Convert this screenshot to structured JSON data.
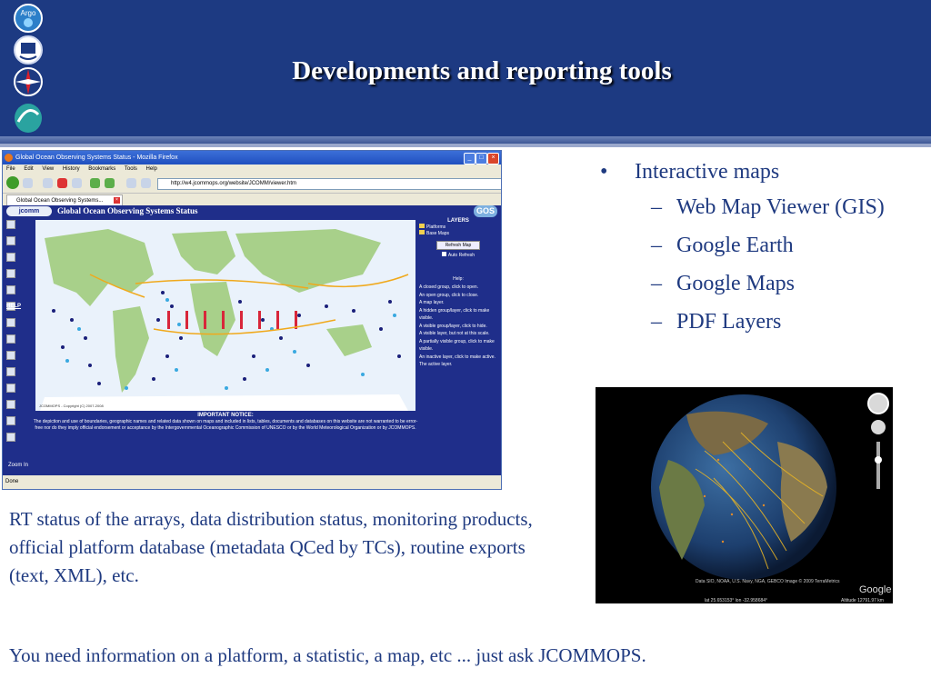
{
  "slide": {
    "title": "Developments and reporting tools",
    "logos": [
      {
        "name": "argo-logo",
        "label": "Argo"
      },
      {
        "name": "ioc-unesco-logo"
      },
      {
        "name": "wmo-compass-logo"
      },
      {
        "name": "jcommops-logo"
      }
    ]
  },
  "browser": {
    "window_title": "Global Ocean Observing Systems Status - Mozilla Firefox",
    "menu": [
      "File",
      "Edit",
      "View",
      "History",
      "Bookmarks",
      "Tools",
      "Help"
    ],
    "url": "http://w4.jcommops.org/website/JCOMM/viewer.htm",
    "tab_label": "Global Ocean Observing Systems...",
    "status": "Done",
    "app": {
      "logo_text": "jcomm",
      "title": "Global Ocean Observing Systems Status",
      "gos_label": "GOS",
      "help_link": "HELP",
      "layers_header": "LAYERS",
      "layer_items": [
        "Platforms",
        "Base Maps"
      ],
      "refresh_button": "Refresh Map",
      "auto_refresh": "Auto Refresh",
      "help_header": "Help:",
      "help_items": [
        "A closed group, click to open.",
        "An open group, click to close.",
        "A map layer.",
        "A hidden group/layer, click to make visible.",
        "A visible group/layer, click to hide.",
        "A visible layer, but not at this scale.",
        "A partially visible group, click to make visible.",
        "An inactive layer, click to make active.",
        "The active layer."
      ],
      "map_copyright": "JCOMMOPS - Copyright (C) 2007-2008",
      "notice_title": "IMPORTANT NOTICE:",
      "notice_text": "The depiction and use of boundaries, geographic names and related data shown on maps and included in lists, tables, documents and databases on this website are not warranted to be error-free nor do they imply official endorsement or acceptance by the Intergovernmental Oceanographic Commission of UNESCO or by the World Meteorological Organization or by JCOMMOPS.",
      "zoom_label": "Zoom In"
    }
  },
  "bullets": {
    "main": "Interactive maps",
    "sub": [
      "Web Map Viewer (GIS)",
      "Google Earth",
      "Google Maps",
      "PDF Layers"
    ]
  },
  "earth": {
    "attribution": "Data SIO, NOAA, U.S. Navy, NGA, GEBCO\nImage © 2009 TerraMetrics",
    "coords": "lat  25.653153°   lon  -32.958684°",
    "altitude": "Altitude 12791.97 km",
    "brand": "Google"
  },
  "caption": "RT status of the arrays, data distribution status, monitoring products, official platform database (metadata QCed by TCs), routine exports  (text, XML), etc.",
  "footer": "You need information on a platform, a statistic, a map, etc ... just ask JCOMMOPS."
}
